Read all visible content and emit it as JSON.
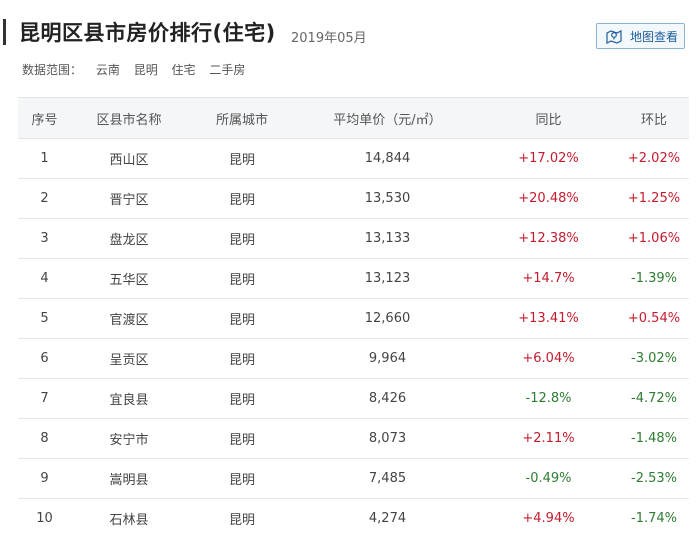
{
  "header": {
    "title": "昆明区县市房价排行(住宅)",
    "date": "2019年05月",
    "map_button_label": "地图查看",
    "map_button_icon": "map-marker-icon"
  },
  "scope": {
    "label": "数据范围：",
    "tags": [
      "云南",
      "昆明",
      "住宅",
      "二手房"
    ]
  },
  "table": {
    "headers": [
      "序号",
      "区县市名称",
      "所属城市",
      "平均单价（元/㎡）",
      "同比",
      "环比"
    ],
    "rows": [
      {
        "rank": "1",
        "name": "西山区",
        "city": "昆明",
        "price": "14,844",
        "yoy": "+17.02%",
        "mom": "+2.02%"
      },
      {
        "rank": "2",
        "name": "晋宁区",
        "city": "昆明",
        "price": "13,530",
        "yoy": "+20.48%",
        "mom": "+1.25%"
      },
      {
        "rank": "3",
        "name": "盘龙区",
        "city": "昆明",
        "price": "13,133",
        "yoy": "+12.38%",
        "mom": "+1.06%"
      },
      {
        "rank": "4",
        "name": "五华区",
        "city": "昆明",
        "price": "13,123",
        "yoy": "+14.7%",
        "mom": "-1.39%"
      },
      {
        "rank": "5",
        "name": "官渡区",
        "city": "昆明",
        "price": "12,660",
        "yoy": "+13.41%",
        "mom": "+0.54%"
      },
      {
        "rank": "6",
        "name": "呈贡区",
        "city": "昆明",
        "price": "9,964",
        "yoy": "+6.04%",
        "mom": "-3.02%"
      },
      {
        "rank": "7",
        "name": "宜良县",
        "city": "昆明",
        "price": "8,426",
        "yoy": "-12.8%",
        "mom": "-4.72%"
      },
      {
        "rank": "8",
        "name": "安宁市",
        "city": "昆明",
        "price": "8,073",
        "yoy": "+2.11%",
        "mom": "-1.48%"
      },
      {
        "rank": "9",
        "name": "嵩明县",
        "city": "昆明",
        "price": "7,485",
        "yoy": "-0.49%",
        "mom": "-2.53%"
      },
      {
        "rank": "10",
        "name": "石林县",
        "city": "昆明",
        "price": "4,274",
        "yoy": "+4.94%",
        "mom": "-1.74%"
      }
    ]
  },
  "colors": {
    "increase": "#c41c2e",
    "decrease": "#2e7d32",
    "map_button_border": "#8ab3d8",
    "map_button_text": "#1e5c99"
  }
}
